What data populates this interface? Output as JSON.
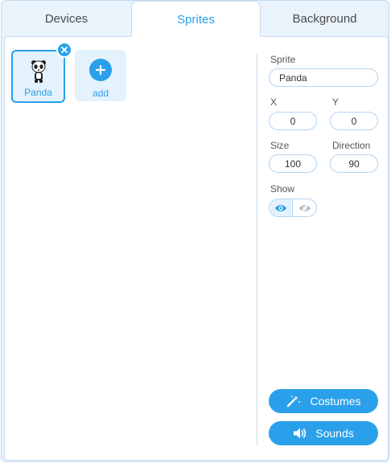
{
  "tabs": [
    {
      "label": "Devices",
      "active": false
    },
    {
      "label": "Sprites",
      "active": true
    },
    {
      "label": "Background",
      "active": false
    }
  ],
  "sprites": [
    {
      "name": "Panda",
      "selected": true
    }
  ],
  "add_label": "add",
  "properties": {
    "sprite_label": "Sprite",
    "sprite_name": "Panda",
    "x_label": "X",
    "x_value": "0",
    "y_label": "Y",
    "y_value": "0",
    "size_label": "Size",
    "size_value": "100",
    "direction_label": "Direction",
    "direction_value": "90",
    "show_label": "Show",
    "show_state": "visible"
  },
  "buttons": {
    "costumes": "Costumes",
    "sounds": "Sounds"
  },
  "colors": {
    "accent": "#2aa0ea",
    "tab_bg": "#e9f3fc",
    "border": "#c6dbef"
  }
}
